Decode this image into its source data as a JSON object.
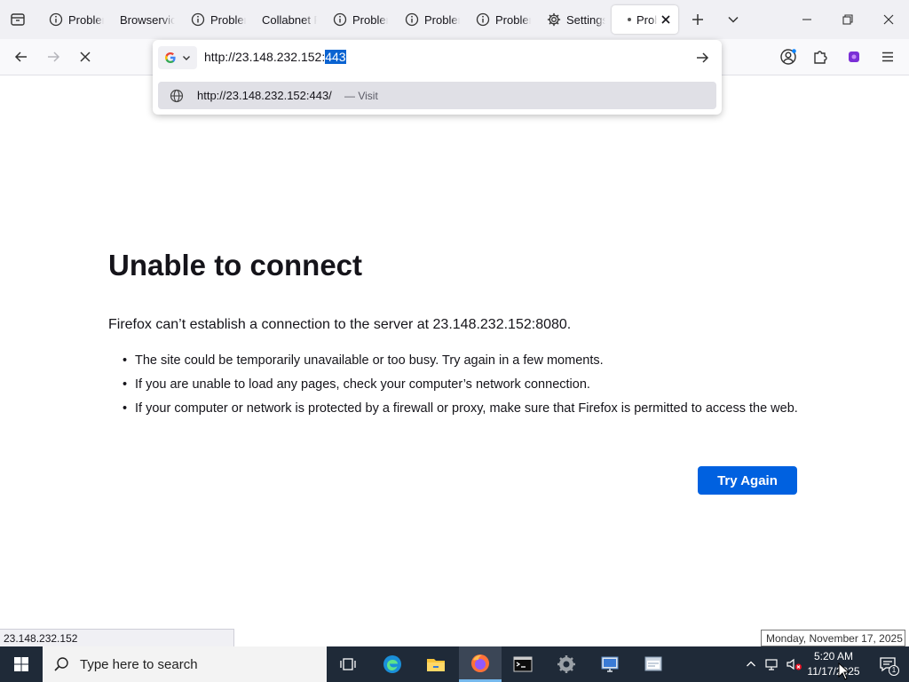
{
  "tabs": [
    {
      "label": "Problem",
      "icon": "info-circle-icon"
    },
    {
      "label": "Browservices",
      "icon": "none"
    },
    {
      "label": "Problem",
      "icon": "info-circle-icon"
    },
    {
      "label": "Collabnet F",
      "icon": "none"
    },
    {
      "label": "Problem",
      "icon": "info-circle-icon"
    },
    {
      "label": "Problem",
      "icon": "info-circle-icon"
    },
    {
      "label": "Problem",
      "icon": "info-circle-icon"
    },
    {
      "label": "Settings",
      "icon": "gear-icon"
    },
    {
      "label": "Prob",
      "icon": "loading-dot-icon",
      "active": true
    }
  ],
  "urlbar": {
    "text_before_selection": "http://23.148.232.152:",
    "selected_text": "443",
    "search_engine": "Google"
  },
  "suggestion": {
    "url": "http://23.148.232.152:443/",
    "action": "— Visit"
  },
  "error": {
    "title": "Unable to connect",
    "description": "Firefox can’t establish a connection to the server at 23.148.232.152:8080.",
    "bullets": [
      "The site could be temporarily unavailable or too busy. Try again in a few moments.",
      "If you are unable to load any pages, check your computer’s network connection.",
      "If your computer or network is protected by a firewall or proxy, make sure that Firefox is permitted to access the web."
    ],
    "button": "Try Again"
  },
  "status_bar": {
    "url": "23.148.232.152"
  },
  "tooltip": {
    "date": "Monday, November 17, 2025"
  },
  "taskbar": {
    "search_placeholder": "Type here to search",
    "time": "5:20 AM",
    "date": "11/17/2025",
    "notification_count": "1"
  },
  "colors": {
    "accent": "#0061e0",
    "selection": "#0a63d1",
    "taskbar": "#1f2a38"
  }
}
